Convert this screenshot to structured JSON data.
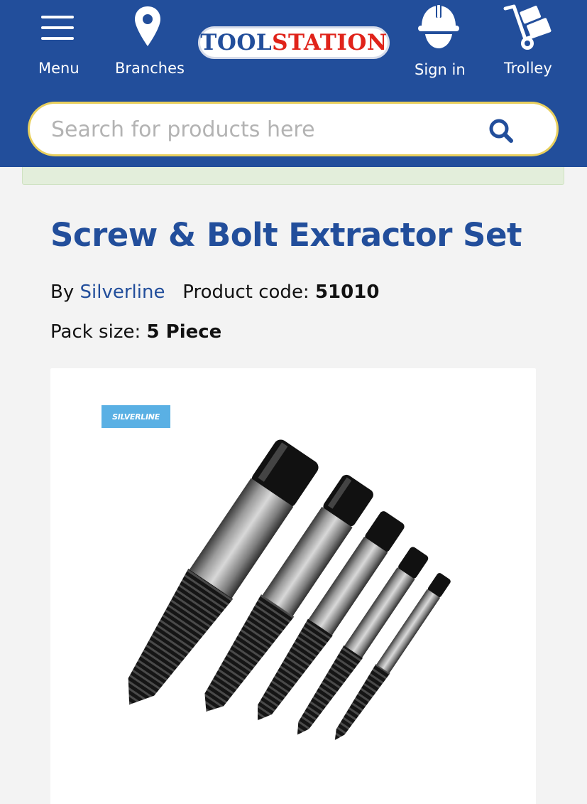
{
  "header": {
    "nav": {
      "menu": "Menu",
      "branches": "Branches",
      "sign_in": "Sign in",
      "trolley": "Trolley"
    },
    "logo": {
      "part1": "TOOL",
      "part2": "STATION"
    },
    "search": {
      "placeholder": "Search for products here",
      "value": ""
    }
  },
  "product": {
    "title": "Screw & Bolt Extractor Set",
    "by_label": "By",
    "brand": "Silverline",
    "code_label": "Product code:",
    "code": "51010",
    "pack_label": "Pack size:",
    "pack": "5 Piece",
    "image": {
      "brand_badge": "SILVERLINE",
      "pieces": 5
    }
  },
  "colors": {
    "brand_blue": "#224e9b",
    "logo_red": "#e0231a",
    "search_border": "#e8cf5d",
    "notice_green": "#e3eedb",
    "badge_blue": "#5ab0e4"
  },
  "icons": {
    "menu": "hamburger-icon",
    "branches": "map-pin-icon",
    "sign_in": "hard-hat-icon",
    "trolley": "hand-truck-icon",
    "search": "search-icon"
  }
}
